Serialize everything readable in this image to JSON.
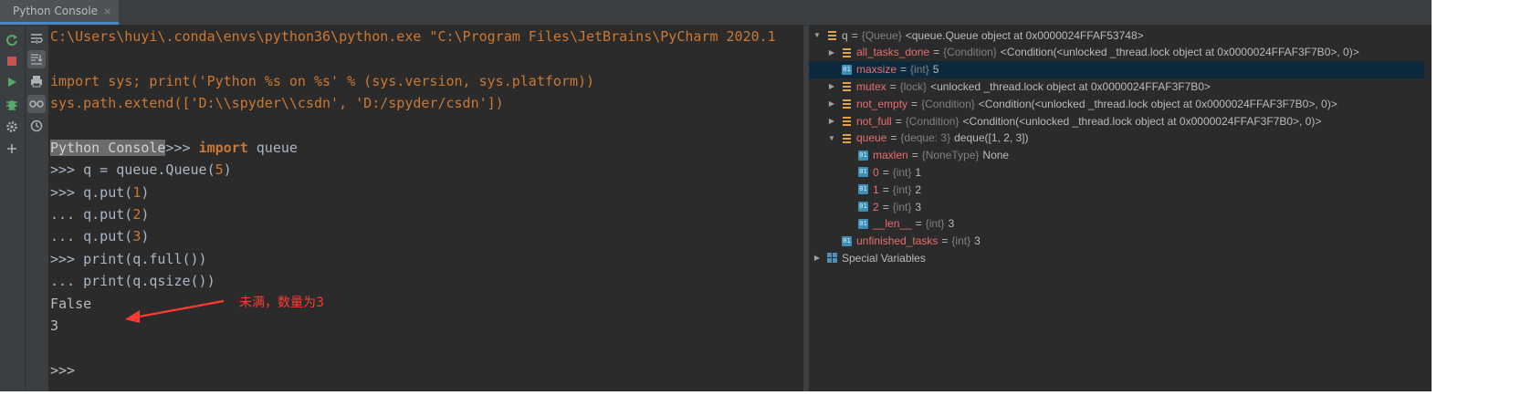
{
  "tab": {
    "title": "Python Console",
    "close": "×"
  },
  "console": {
    "startup": "C:\\Users\\huyi\\.conda\\envs\\python36\\python.exe \"C:\\Program Files\\JetBrains\\PyCharm 2020.1",
    "import_sys_a": "import sys; print('Python %s on %s' % (sys.version, sys.platform))",
    "path_extend_a": "sys.path.extend([",
    "path_extend_s1": "'D:\\\\spyder\\\\csdn'",
    "path_extend_comma": ", ",
    "path_extend_s2": "'D:/spyder/csdn'",
    "path_extend_end": "])",
    "prompt_label": "Python Console",
    "prompt": ">>> ",
    "cont": "... ",
    "kw_import": "import",
    "import_rest": " queue",
    "l1_a": "q = queue.Queue(",
    "l1_n": "5",
    "l1_b": ")",
    "l2_a": "q.put(",
    "l2_n": "1",
    "l2_b": ")",
    "l3_a": "q.put(",
    "l3_n": "2",
    "l3_b": ")",
    "l4_a": "q.put(",
    "l4_n": "3",
    "l4_b": ")",
    "l5": "print(q.full())",
    "l6": "print(q.qsize())",
    "out1": "False",
    "out2": "3",
    "empty_prompt": ">>>"
  },
  "annotation": {
    "text": "未满，数量为3",
    "color": "#ff3b30"
  },
  "variables": [
    {
      "indent": 0,
      "expand": "▼",
      "icon": "obj",
      "name": "q",
      "type": "{Queue}",
      "value": "<queue.Queue object at 0x0000024FFAF53748>",
      "name_color": "default"
    },
    {
      "indent": 1,
      "expand": "▶",
      "icon": "obj",
      "name": "all_tasks_done",
      "type": "{Condition}",
      "value": "<Condition(<unlocked _thread.lock object at 0x0000024FFAF3F7B0>, 0)>"
    },
    {
      "indent": 1,
      "expand": "",
      "icon": "prim",
      "name": "maxsize",
      "type": "{int}",
      "value": "5",
      "selected": true
    },
    {
      "indent": 1,
      "expand": "▶",
      "icon": "obj",
      "name": "mutex",
      "type": "{lock}",
      "value": "<unlocked _thread.lock object at 0x0000024FFAF3F7B0>"
    },
    {
      "indent": 1,
      "expand": "▶",
      "icon": "obj",
      "name": "not_empty",
      "type": "{Condition}",
      "value": "<Condition(<unlocked _thread.lock object at 0x0000024FFAF3F7B0>, 0)>"
    },
    {
      "indent": 1,
      "expand": "▶",
      "icon": "obj",
      "name": "not_full",
      "type": "{Condition}",
      "value": "<Condition(<unlocked _thread.lock object at 0x0000024FFAF3F7B0>, 0)>"
    },
    {
      "indent": 1,
      "expand": "▼",
      "icon": "obj",
      "name": "queue",
      "type": "{deque: 3}",
      "value": "deque([1, 2, 3])"
    },
    {
      "indent": 2,
      "expand": "",
      "icon": "prim",
      "name": "maxlen",
      "type": "{NoneType}",
      "value": "None"
    },
    {
      "indent": 2,
      "expand": "",
      "icon": "prim",
      "name": "0",
      "type": "{int}",
      "value": "1"
    },
    {
      "indent": 2,
      "expand": "",
      "icon": "prim",
      "name": "1",
      "type": "{int}",
      "value": "2"
    },
    {
      "indent": 2,
      "expand": "",
      "icon": "prim",
      "name": "2",
      "type": "{int}",
      "value": "3"
    },
    {
      "indent": 2,
      "expand": "",
      "icon": "prim",
      "name": "__len__",
      "type": "{int}",
      "value": "3"
    },
    {
      "indent": 1,
      "expand": "",
      "icon": "prim",
      "name": "unfinished_tasks",
      "type": "{int}",
      "value": "3"
    },
    {
      "indent": 0,
      "expand": "▶",
      "icon": "spec",
      "name": "Special Variables",
      "type": "",
      "value": "",
      "plain": true
    }
  ],
  "icons": {
    "tool1": [
      "rerun-icon",
      "stop-icon",
      "run-icon",
      "debug-icon",
      "settings-icon",
      "add-icon"
    ],
    "tool2": [
      "soft-wrap-icon",
      "scroll-to-end-icon",
      "print-icon",
      "show-variables-icon",
      "history-icon"
    ]
  }
}
